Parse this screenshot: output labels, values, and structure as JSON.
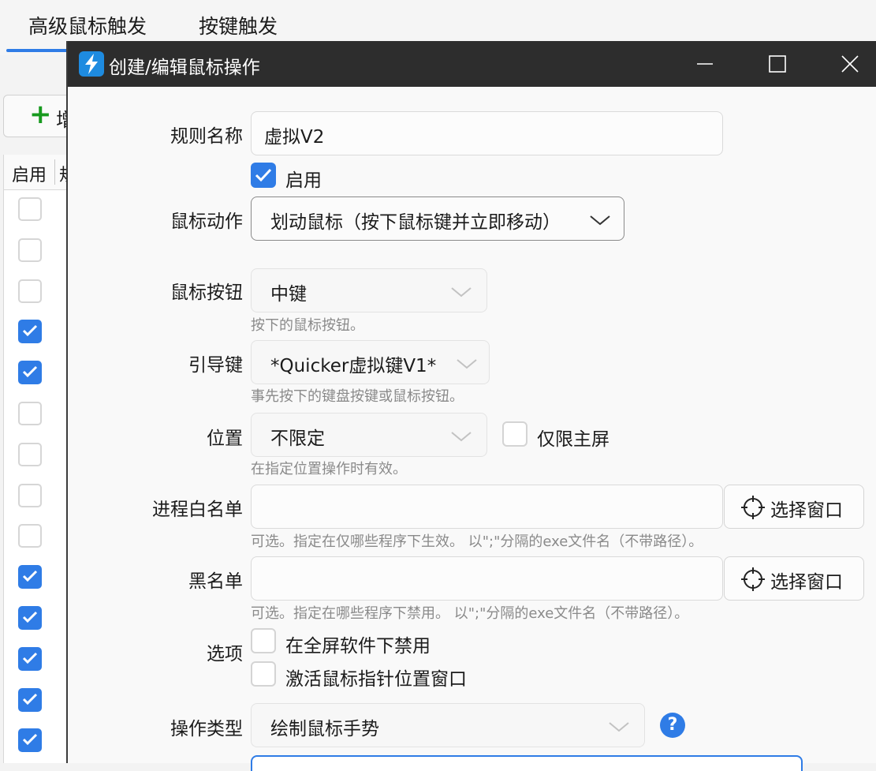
{
  "background": {
    "tabs": [
      "高级鼠标触发",
      "按键触发"
    ],
    "add_button_label": "增",
    "grid_header": [
      "启用",
      "规"
    ],
    "checkbox_states": [
      false,
      false,
      false,
      true,
      true,
      false,
      false,
      false,
      false,
      true,
      true,
      true,
      true,
      true
    ]
  },
  "dialog": {
    "title": "创建/编辑鼠标操作",
    "rule_name_label": "规则名称",
    "rule_name_value": "虚拟V2",
    "enabled_label": "启用",
    "enabled": true,
    "mouse_action_label": "鼠标动作",
    "mouse_action_value": "划动鼠标（按下鼠标键并立即移动）",
    "mouse_button_label": "鼠标按钮",
    "mouse_button_value": "中键",
    "mouse_button_hint": "按下的鼠标按钮。",
    "lead_key_label": "引导键",
    "lead_key_value": "*Quicker虚拟键V1*",
    "lead_key_hint": "事先按下的键盘按键或鼠标按钮。",
    "position_label": "位置",
    "position_value": "不限定",
    "primary_screen_label": "仅限主屏",
    "primary_screen_checked": false,
    "position_hint": "在指定位置操作时有效。",
    "whitelist_label": "进程白名单",
    "whitelist_value": "",
    "whitelist_hint": "可选。指定在仅哪些程序下生效。 以\";\"分隔的exe文件名（不带路径）。",
    "blacklist_label": "黑名单",
    "blacklist_value": "",
    "blacklist_hint": "可选。指定在哪些程序下禁用。 以\";\"分隔的exe文件名（不带路径）。",
    "select_window_label": "选择窗口",
    "options_label": "选项",
    "option_fullscreen_label": "在全屏软件下禁用",
    "option_fullscreen_checked": false,
    "option_activate_label": "激活鼠标指针位置窗口",
    "option_activate_checked": false,
    "op_type_label": "操作类型",
    "op_type_value": "绘制鼠标手势",
    "help_glyph": "?"
  },
  "colors": {
    "accent": "#2f7ce6",
    "titlebar": "#2d2d2d",
    "add_green": "#189a1f"
  }
}
